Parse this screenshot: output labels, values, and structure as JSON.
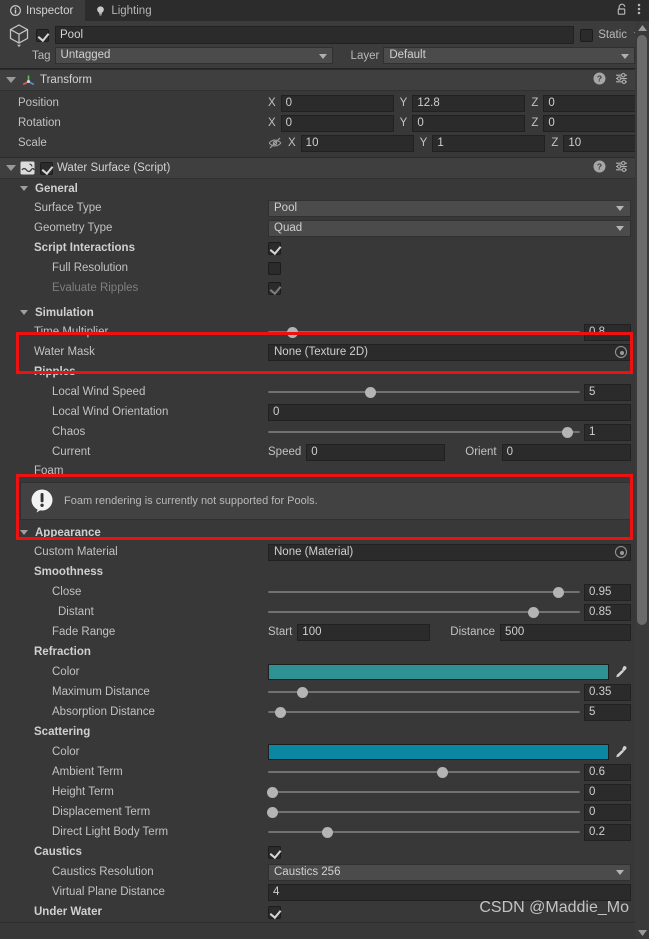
{
  "tabs": [
    {
      "label": "Inspector",
      "icon": "info-icon",
      "active": true
    },
    {
      "label": "Lighting",
      "icon": "light-bulb-icon",
      "active": false
    }
  ],
  "window_tools": {
    "lock": "lock-open-icon",
    "menu": "kebab-menu-icon"
  },
  "object_header": {
    "icon": "game-object-cube-icon",
    "enabled": true,
    "name": "Pool",
    "static_label": "Static",
    "static_checked": false,
    "tag_label": "Tag",
    "tag_value": "Untagged",
    "layer_label": "Layer",
    "layer_value": "Default"
  },
  "components": [
    {
      "title": "Transform",
      "icon": "transform-axis-icon",
      "expanded": true,
      "header_buttons": [
        "help-icon",
        "preset-icon",
        "kebab-menu-icon"
      ],
      "rows": [
        {
          "label": "Position",
          "axes": [
            {
              "name": "X",
              "value": "0"
            },
            {
              "name": "Y",
              "value": "12.8"
            },
            {
              "name": "Z",
              "value": "0"
            }
          ]
        },
        {
          "label": "Rotation",
          "axes": [
            {
              "name": "X",
              "value": "0"
            },
            {
              "name": "Y",
              "value": "0"
            },
            {
              "name": "Z",
              "value": "0"
            }
          ]
        },
        {
          "label": "Scale",
          "constrain_icon": "constrain-proportions-off-icon",
          "axes": [
            {
              "name": "X",
              "value": "10"
            },
            {
              "name": "Y",
              "value": "1"
            },
            {
              "name": "Z",
              "value": "10"
            }
          ]
        }
      ]
    }
  ],
  "water_surface": {
    "title": "Water Surface (Script)",
    "icon": "script-wave-icon",
    "enabled": true,
    "expanded": true,
    "header_buttons": [
      "help-icon",
      "preset-icon",
      "kebab-menu-icon"
    ],
    "sections": {
      "general": {
        "title": "General",
        "surface_type": {
          "label": "Surface Type",
          "value": "Pool"
        },
        "geometry_type": {
          "label": "Geometry Type",
          "value": "Quad"
        },
        "script_interactions": {
          "label": "Script Interactions",
          "checked": true
        },
        "full_resolution": {
          "label": "Full Resolution",
          "checked": false
        },
        "evaluate_ripples": {
          "label": "Evaluate Ripples",
          "checked": true,
          "disabled": true
        }
      },
      "simulation": {
        "title": "Simulation",
        "time_multiplier": {
          "label": "Time Multiplier",
          "value": "0.8",
          "slider_pct": 8
        },
        "water_mask": {
          "label": "Water Mask",
          "value": "None (Texture 2D)"
        },
        "ripples_title": "Ripples",
        "local_wind_speed": {
          "label": "Local Wind Speed",
          "value": "5",
          "slider_pct": 33
        },
        "local_wind_orientation": {
          "label": "Local Wind Orientation",
          "value": "0"
        },
        "chaos": {
          "label": "Chaos",
          "value": "1",
          "slider_pct": 96
        },
        "current": {
          "label": "Current",
          "speed_label": "Speed",
          "speed_value": "0",
          "orient_label": "Orient",
          "orient_value": "0"
        },
        "foam_title": "Foam",
        "foam_warning": {
          "icon": "warning-exclamation-icon",
          "text": "Foam rendering is currently not supported for Pools."
        }
      },
      "appearance": {
        "title": "Appearance",
        "custom_material": {
          "label": "Custom Material",
          "value": "None (Material)"
        },
        "smoothness_title": "Smoothness",
        "close": {
          "label": "Close",
          "value": "0.95",
          "slider_pct": 93
        },
        "distant": {
          "label": "Distant",
          "value": "0.85",
          "slider_pct": 85
        },
        "fade_range": {
          "label": "Fade Range",
          "start_label": "Start",
          "start_value": "100",
          "distance_label": "Distance",
          "distance_value": "500"
        },
        "refraction_title": "Refraction",
        "refraction_color": {
          "label": "Color",
          "hex": "#2e9193",
          "eyedropper": "eyedropper-icon"
        },
        "maximum_distance": {
          "label": "Maximum Distance",
          "value": "0.35",
          "slider_pct": 11
        },
        "absorption_distance": {
          "label": "Absorption Distance",
          "value": "5",
          "slider_pct": 4
        },
        "scattering_title": "Scattering",
        "scattering_color": {
          "label": "Color",
          "hex": "#0b87a2",
          "eyedropper": "eyedropper-icon"
        },
        "ambient_term": {
          "label": "Ambient Term",
          "value": "0.6",
          "slider_pct": 56
        },
        "height_term": {
          "label": "Height Term",
          "value": "0",
          "slider_pct": 1
        },
        "displacement_term": {
          "label": "Displacement Term",
          "value": "0",
          "slider_pct": 1
        },
        "direct_light_body_term": {
          "label": "Direct Light Body Term",
          "value": "0.2",
          "slider_pct": 19
        },
        "caustics": {
          "label": "Caustics",
          "checked": true
        },
        "caustics_resolution": {
          "label": "Caustics Resolution",
          "value": "Caustics 256"
        },
        "virtual_plane_distance": {
          "label": "Virtual Plane Distance",
          "value": "4"
        },
        "under_water": {
          "label": "Under Water",
          "checked": true
        }
      }
    }
  },
  "watermark": "CSDN @Maddie_Mo",
  "colors": {
    "annotation_red": "#ee1111",
    "panel_bg": "#383838",
    "header_bg": "#3c3c3c"
  }
}
